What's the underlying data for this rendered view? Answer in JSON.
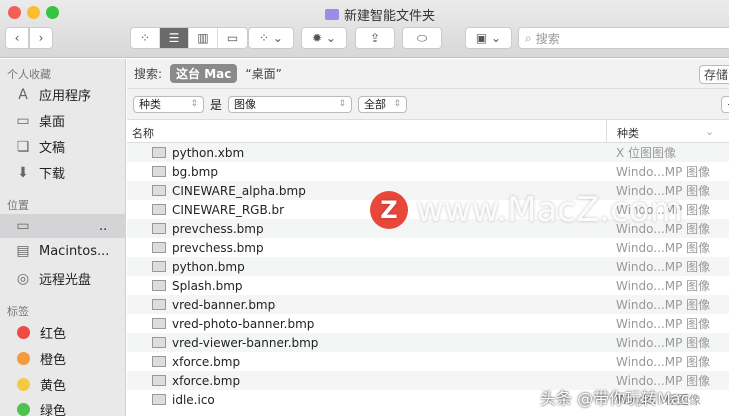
{
  "window": {
    "title": "新建智能文件夹"
  },
  "toolbar": {
    "search_placeholder": "搜索",
    "back": "‹",
    "forward": "›"
  },
  "sidebar": {
    "favorites_header": "个人收藏",
    "favorites": [
      {
        "label": "应用程序",
        "icon": "applications-icon"
      },
      {
        "label": "桌面",
        "icon": "desktop-icon"
      },
      {
        "label": "文稿",
        "icon": "documents-icon"
      },
      {
        "label": "下载",
        "icon": "downloads-icon"
      }
    ],
    "locations_header": "位置",
    "locations": [
      {
        "label": "..",
        "icon": "computer-icon"
      },
      {
        "label": "Macintos...",
        "icon": "disk-icon"
      },
      {
        "label": "远程光盘",
        "icon": "optical-disc-icon"
      }
    ],
    "tags_header": "标签",
    "tags": [
      {
        "label": "红色",
        "color": "#f04a45"
      },
      {
        "label": "橙色",
        "color": "#f59b3c"
      },
      {
        "label": "黄色",
        "color": "#f6c945"
      },
      {
        "label": "绿色",
        "color": "#4cc34d"
      }
    ]
  },
  "search_bar": {
    "label": "搜索:",
    "scope_active": "这台 Mac",
    "scope_other": "“桌面”",
    "save": "存储"
  },
  "criteria": {
    "attribute": "种类",
    "operator": "是",
    "value": "图像",
    "sub": "全部",
    "remove": "−"
  },
  "columns": {
    "name": "名称",
    "kind": "种类"
  },
  "files": [
    {
      "name": "python.xbm",
      "kind": "X 位图图像"
    },
    {
      "name": "bg.bmp",
      "kind": "Windo...MP 图像"
    },
    {
      "name": "CINEWARE_alpha.bmp",
      "kind": "Windo...MP 图像"
    },
    {
      "name": "CINEWARE_RGB.br",
      "kind": "Windo...MP 图像"
    },
    {
      "name": "prevchess.bmp",
      "kind": "Windo...MP 图像"
    },
    {
      "name": "prevchess.bmp",
      "kind": "Windo...MP 图像"
    },
    {
      "name": "python.bmp",
      "kind": "Windo...MP 图像"
    },
    {
      "name": "Splash.bmp",
      "kind": "Windo...MP 图像"
    },
    {
      "name": "vred-banner.bmp",
      "kind": "Windo...MP 图像"
    },
    {
      "name": "vred-photo-banner.bmp",
      "kind": "Windo...MP 图像"
    },
    {
      "name": "vred-viewer-banner.bmp",
      "kind": "Windo...MP 图像"
    },
    {
      "name": "xforce.bmp",
      "kind": "Windo...MP 图像"
    },
    {
      "name": "xforce.bmp",
      "kind": "Windo...MP 图像"
    },
    {
      "name": "idle.ico",
      "kind": "Windo...标图像"
    }
  ],
  "watermark": {
    "site": "www.MacZ.com",
    "logo": "Z",
    "credit": "头条 @带你玩转Mac"
  }
}
